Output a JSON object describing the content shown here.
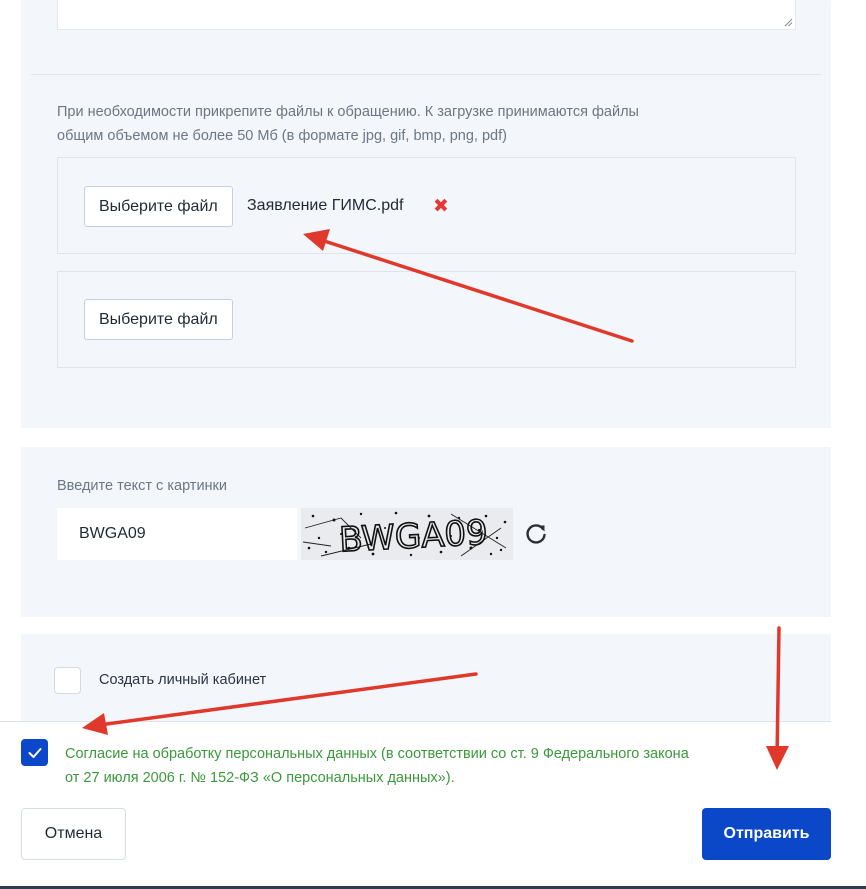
{
  "attachments": {
    "hint_line1": "При необходимости прикрепите файлы к обращению. К загрузке принимаются файлы",
    "hint_line2": "общим объемом не более 50 Мб (в формате jpg, gif, bmp, png, pdf)",
    "slots": [
      {
        "button_label": "Выберите файл",
        "file_name": "Заявление ГИМС.pdf",
        "remove_icon": "close-icon"
      },
      {
        "button_label": "Выберите файл",
        "file_name": ""
      }
    ]
  },
  "captcha": {
    "label": "Введите текст с картинки",
    "input_value": "BWGA09",
    "image_text": "BWGA09",
    "refresh_icon": "refresh-icon"
  },
  "account": {
    "label": "Создать личный кабинет",
    "checked": false
  },
  "consent": {
    "line1": "Согласие на обработку персональных данных (в соответствии со ст. 9 Федерального закона",
    "line2": "от 27 июля 2006 г. № 152-ФЗ «О персональных данных»).",
    "checked": true
  },
  "actions": {
    "cancel_label": "Отмена",
    "submit_label": "Отправить"
  },
  "colors": {
    "accent": "#0b47c9",
    "consent_text": "#3a9a3a",
    "remove": "#e53935",
    "annotation_arrow": "#e0392b"
  }
}
